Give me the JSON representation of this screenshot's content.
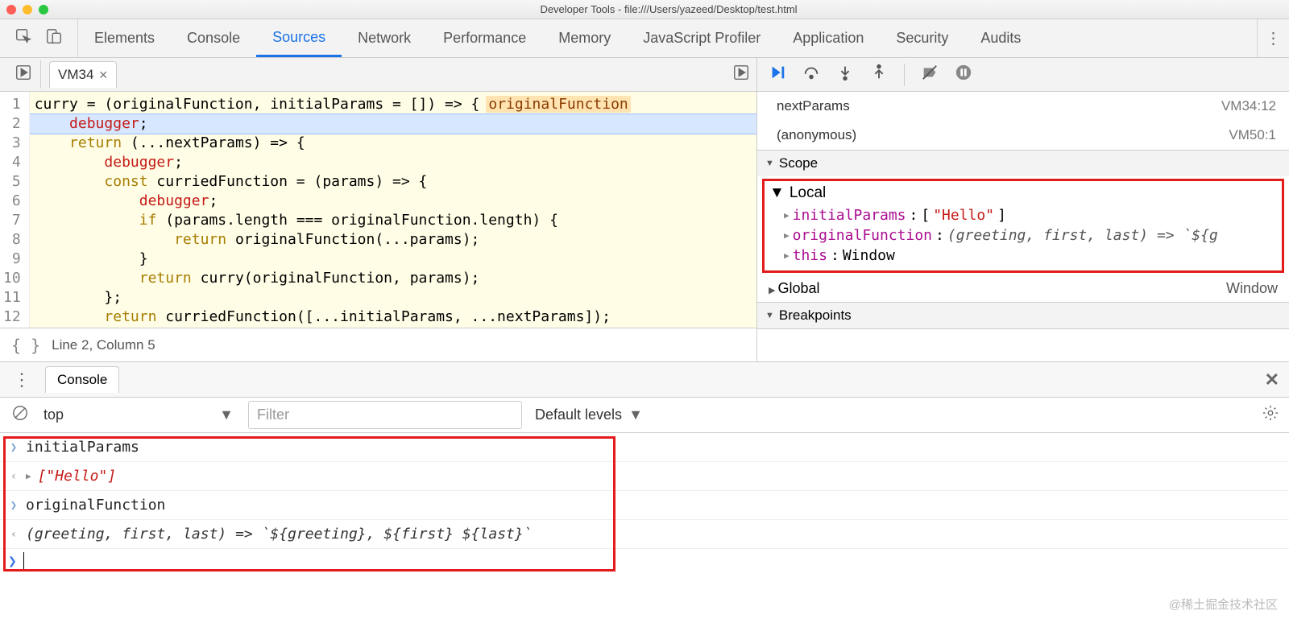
{
  "title": "Developer Tools - file:///Users/yazeed/Desktop/test.html",
  "toolbar_tabs": [
    "Elements",
    "Console",
    "Sources",
    "Network",
    "Performance",
    "Memory",
    "JavaScript Profiler",
    "Application",
    "Security",
    "Audits"
  ],
  "toolbar_active": "Sources",
  "file_tab": {
    "name": "VM34",
    "closable": true
  },
  "editor": {
    "hint": "originalFunction",
    "highlight_line": 2,
    "lines": [
      "curry = (originalFunction, initialParams = []) => {",
      "    debugger;",
      "    return (...nextParams) => {",
      "        debugger;",
      "        const curriedFunction = (params) => {",
      "            debugger;",
      "            if (params.length === originalFunction.length) {",
      "                return originalFunction(...params);",
      "            }",
      "            return curry(originalFunction, params);",
      "        };",
      "        return curriedFunction([...initialParams, ...nextParams]);"
    ]
  },
  "status": "Line 2, Column 5",
  "callstack": [
    {
      "name": "nextParams",
      "loc": "VM34:12"
    },
    {
      "name": "(anonymous)",
      "loc": "VM50:1"
    }
  ],
  "scope": {
    "header": "Scope",
    "local_label": "Local",
    "local": [
      {
        "k": "initialParams",
        "v": "[\"Hello\"]",
        "kind": "str"
      },
      {
        "k": "originalFunction",
        "v": "(greeting, first, last) => `${g",
        "kind": "obj"
      },
      {
        "k": "this",
        "v": "Window",
        "kind": "plain"
      }
    ],
    "global_label": "Global",
    "global_value": "Window"
  },
  "breakpoints_label": "Breakpoints",
  "console": {
    "tab": "Console",
    "context": "top",
    "filter_placeholder": "Filter",
    "levels": "Default levels",
    "rows": [
      {
        "dir": "in",
        "text": "initialParams"
      },
      {
        "dir": "out",
        "expand": true,
        "text": "[\"Hello\"]",
        "ital": true
      },
      {
        "dir": "in",
        "text": "originalFunction"
      },
      {
        "dir": "out",
        "text": "(greeting, first, last) => `${greeting}, ${first} ${last}`",
        "fn": true
      }
    ]
  },
  "watermark": "@稀土掘金技术社区"
}
